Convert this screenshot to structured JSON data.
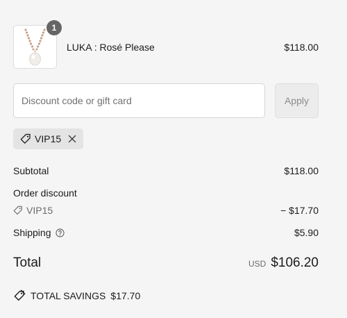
{
  "product": {
    "name": "LUKA : Rosé Please",
    "price": "$118.00",
    "quantity": "1",
    "image_icon": "necklace-product-image"
  },
  "discount": {
    "placeholder": "Discount code or gift card",
    "value": "",
    "apply_label": "Apply",
    "applied_code": "VIP15"
  },
  "summary": {
    "subtotal_label": "Subtotal",
    "subtotal_value": "$118.00",
    "order_discount_label": "Order discount",
    "discount_code": "VIP15",
    "discount_value": "− $17.70",
    "shipping_label": "Shipping",
    "shipping_value": "$5.90",
    "total_label": "Total",
    "currency": "USD",
    "total_value": "$106.20",
    "savings_label": "TOTAL SAVINGS",
    "savings_value": "$17.70"
  },
  "colors": {
    "background": "#f5f5f5",
    "badge": "#666666",
    "chip": "#e4e4e4",
    "muted_text": "#6b6b6b"
  }
}
